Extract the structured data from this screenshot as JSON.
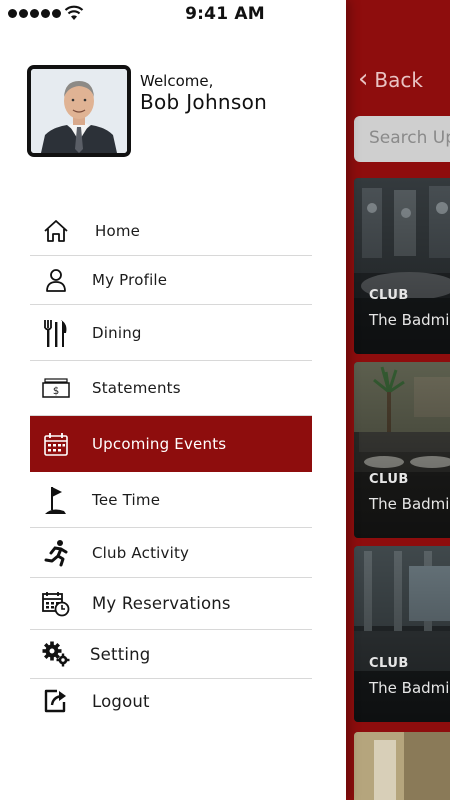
{
  "status_bar": {
    "time": "9:41 AM"
  },
  "header": {
    "welcome": "Welcome,",
    "user_name": "Bob Johnson"
  },
  "menu": {
    "items": [
      {
        "label": "Home",
        "icon": "home-icon"
      },
      {
        "label": "My Profile",
        "icon": "user-icon"
      },
      {
        "label": "Dining",
        "icon": "fork-knife-icon"
      },
      {
        "label": "Statements",
        "icon": "cash-icon"
      },
      {
        "label": "Upcoming Events",
        "icon": "calendar-icon",
        "active": true
      },
      {
        "label": "Tee Time",
        "icon": "golf-flag-icon"
      },
      {
        "label": "Club Activity",
        "icon": "running-icon"
      },
      {
        "label": "My Reservations",
        "icon": "calendar-clock-icon"
      },
      {
        "label": "Setting",
        "icon": "gears-icon"
      },
      {
        "label": "Logout",
        "icon": "logout-icon"
      }
    ]
  },
  "background": {
    "back_label": "Back",
    "search_placeholder": "Search Up",
    "cards": [
      {
        "tag": "CLUB",
        "title": "The Badmi"
      },
      {
        "tag": "CLUB",
        "title": "The Badmi"
      },
      {
        "tag": "CLUB",
        "title": "The Badmi"
      }
    ]
  },
  "colors": {
    "accent": "#8e0d0d",
    "divider": "#d8d8d8",
    "search_bg": "#cfcfcf"
  }
}
